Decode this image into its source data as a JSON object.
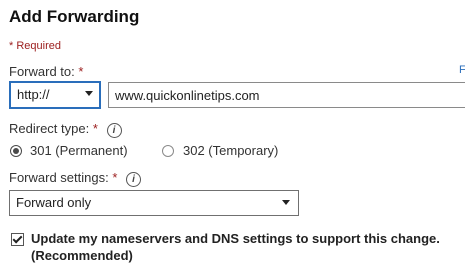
{
  "dialog": {
    "title": "Add Forwarding",
    "required_note": "* Required"
  },
  "forward_to": {
    "label": "Forward to:",
    "required_marker": "*",
    "protocol_selected": "http://",
    "domain_value": "www.quickonlinetips.com",
    "link_fragment": "F"
  },
  "redirect_type": {
    "label": "Redirect type:",
    "required_marker": "*",
    "help_icon": "i",
    "options": [
      {
        "label": "301 (Permanent)",
        "selected": true
      },
      {
        "label": "302 (Temporary)",
        "selected": false
      }
    ]
  },
  "forward_settings": {
    "label": "Forward settings:",
    "required_marker": "*",
    "help_icon": "i",
    "selected": "Forward only"
  },
  "nameservers": {
    "checked": true,
    "label_line1": "Update my nameservers and DNS settings to support this change.",
    "label_line2": "(Recommended)"
  },
  "colors": {
    "required_red": "#9b1c1c",
    "focus_blue": "#2a6ebb"
  }
}
